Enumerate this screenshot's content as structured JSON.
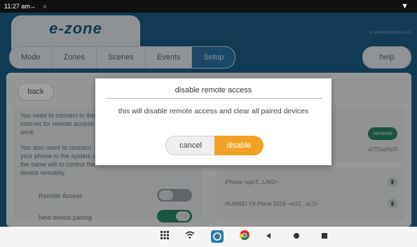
{
  "status_bar": {
    "time": "11:27 am",
    "left_icons": "→ ○",
    "wifi": "▼"
  },
  "app": {
    "logo": "e-zone",
    "brand": "ELANADVANTAGE.AU",
    "nav": [
      "Mode",
      "Zones",
      "Scenes",
      "Events",
      "Setup"
    ],
    "nav_active": "Setup",
    "help": "help"
  },
  "content": {
    "back": "back",
    "left_text_1": "You need to connect to the internet for remote access to work",
    "left_text_2": "You also need to connect your phone to the system on the same wifi to control the device remotely.",
    "remote_access_label": "Remote Access",
    "pairing_label": "New device pairing",
    "rename": "rename",
    "token": "aITDsaNyD",
    "devices": [
      {
        "name": "iPhone <qmT...UW2>"
      },
      {
        "name": "HUAWEI Y9 Prime 2019 <eUZ...eL2>"
      }
    ]
  },
  "dialog": {
    "title": "disable remote access",
    "message": "this will disable remote access and clear all paired devices",
    "cancel": "cancel",
    "disable": "disable",
    "accent": "#f2a127"
  },
  "nav_bar": {
    "icons": [
      "apps-icon",
      "wifi-icon",
      "ezone-app-icon",
      "chrome-icon",
      "back-icon",
      "home-icon",
      "recents-icon"
    ]
  }
}
